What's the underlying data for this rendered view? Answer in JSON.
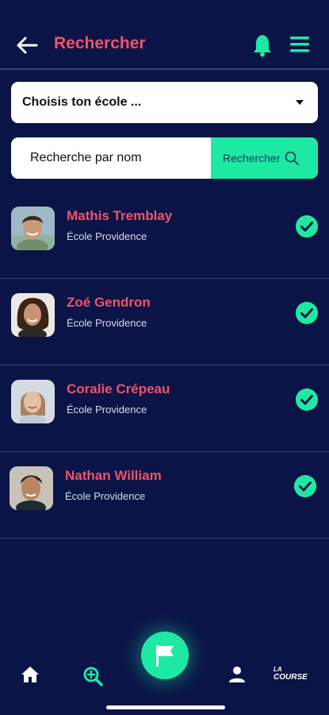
{
  "header": {
    "title": "Rechercher"
  },
  "school_select": {
    "value": "Choisis ton école ..."
  },
  "search": {
    "placeholder": "Recherche par nom",
    "button_label": "Rechercher"
  },
  "students": [
    {
      "name": "Mathis Tremblay",
      "school": "École Providence",
      "selected": true
    },
    {
      "name": "Zoé Gendron",
      "school": "École Providence",
      "selected": true
    },
    {
      "name": "Coralie Crépeau",
      "school": "École Providence",
      "selected": true
    },
    {
      "name": "Nathan William",
      "school": "École Providence",
      "selected": true
    }
  ],
  "nav": {
    "logo_line1": "LA",
    "logo_line2": "COURSE"
  },
  "colors": {
    "background": "#0b1446",
    "accent": "#1de9a3",
    "name": "#f0536a"
  }
}
